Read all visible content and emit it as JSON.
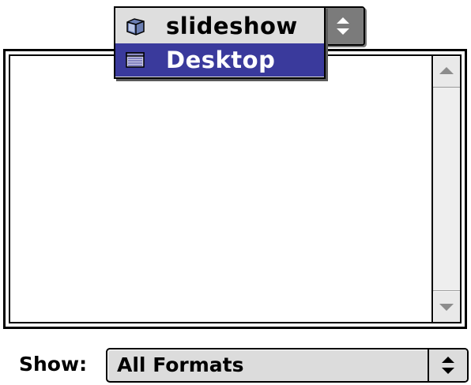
{
  "folder_popup": {
    "items": [
      {
        "label": "slideshow",
        "icon": "folder-icon",
        "selected": false
      },
      {
        "label": "Desktop",
        "icon": "desktop-icon",
        "selected": true
      }
    ],
    "highlight_color": "#3a3a9c"
  },
  "file_list": {
    "items": []
  },
  "show": {
    "label": "Show:",
    "value": "All Formats"
  }
}
